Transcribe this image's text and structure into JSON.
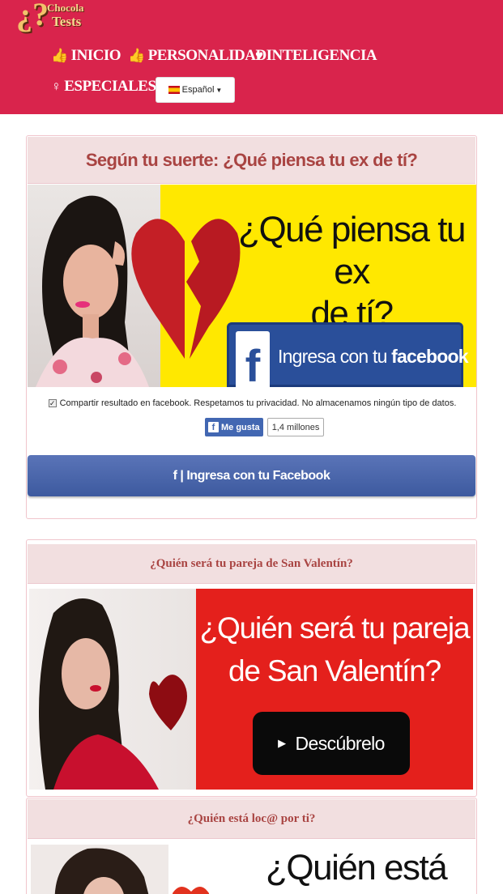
{
  "brand": {
    "logo_mark": "¿?",
    "logo_line1": "Chocola",
    "logo_line2": "Tests"
  },
  "nav": {
    "items": [
      {
        "label": "INICIO",
        "icon": "thumbs-up-icon"
      },
      {
        "label": "PERSONALIDAD",
        "icon": "thumbs-up-icon"
      },
      {
        "label": "INTELIGENCIA",
        "icon": "heart-icon"
      },
      {
        "label": "ESPECIALES",
        "icon": "female-icon"
      }
    ],
    "language": {
      "flag": "spain-flag-icon",
      "label": "Español"
    }
  },
  "quiz1": {
    "title": "Según tu suerte: ¿Qué piensa tu ex de tí?",
    "banner_line1": "¿Qué piensa tu ex",
    "banner_line2": "de tí?",
    "banner_fb_text": "Ingresa con tu",
    "banner_fb_brand": "facebook",
    "share_text": "Compartir resultado en facebook. Respetamos tu privacidad. No almacenamos ningún tipo de datos.",
    "like_label": "Me gusta",
    "like_count": "1,4 millones",
    "button_label": "f | Ingresa con tu Facebook"
  },
  "quiz2": {
    "title": "¿Quién será tu pareja de San Valentín?",
    "banner_line1": "¿Quién será tu pareja",
    "banner_line2": "de San Valentín?",
    "cta": "Descúbrelo"
  },
  "quiz3": {
    "title": "¿Quién está loc@ por ti?",
    "banner_line1": "¿Quién está"
  },
  "colors": {
    "header": "#d9244c",
    "title_text": "#a94442",
    "title_bg": "#f2dfe0",
    "facebook": "#3d5a9f"
  }
}
